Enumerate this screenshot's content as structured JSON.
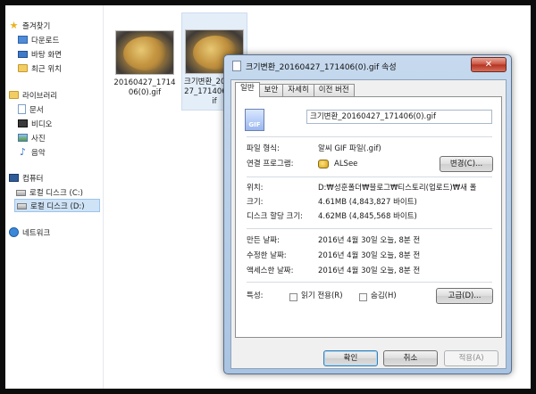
{
  "nav": {
    "items": [
      {
        "label": "즐겨찾기",
        "icon": "star-icon"
      },
      {
        "label": "다운로드",
        "icon": "download-folder-icon"
      },
      {
        "label": "바탕 화면",
        "icon": "desktop-icon"
      },
      {
        "label": "최근 위치",
        "icon": "recent-places-icon"
      },
      {
        "label": "라이브러리",
        "icon": "library-icon"
      },
      {
        "label": "문서",
        "icon": "documents-icon"
      },
      {
        "label": "비디오",
        "icon": "video-icon"
      },
      {
        "label": "사진",
        "icon": "pictures-icon"
      },
      {
        "label": "음악",
        "icon": "music-icon"
      },
      {
        "label": "컴퓨터",
        "icon": "computer-icon"
      },
      {
        "label": "로컬 디스크 (C:)",
        "icon": "drive-c-icon"
      },
      {
        "label": "로컬 디스크 (D:)",
        "icon": "drive-d-icon"
      },
      {
        "label": "네트워크",
        "icon": "network-icon"
      }
    ]
  },
  "files": [
    {
      "name": "20160427_171406(0).gif"
    },
    {
      "name": "크기변환_20160427_171406(0).gif"
    }
  ],
  "dialog": {
    "title": "크기변환_20160427_171406(0).gif 속성",
    "close_label": "✕",
    "tabs": [
      "일반",
      "보안",
      "자세히",
      "이전 버전"
    ],
    "file_name": "크기변환_20160427_171406(0).gif",
    "file_icon_text": "GIF",
    "file_type_label": "파일 형식:",
    "file_type_value": "알씨 GIF 파일(.gif)",
    "opens_with_label": "연결 프로그램:",
    "opens_with_value": "ALSee",
    "change_button": "변경(C)...",
    "location_label": "위치:",
    "location_value": "D:₩성훈폴더₩블로그₩티스토리(업로드)₩새 폴",
    "size_label": "크기:",
    "size_value": "4.61MB (4,843,827 바이트)",
    "size_on_disk_label": "디스크 할당 크기:",
    "size_on_disk_value": "4.62MB (4,845,568 바이트)",
    "created_label": "만든 날짜:",
    "created_value": "2016년 4월 30일 오늘, 8분 전",
    "modified_label": "수정한 날짜:",
    "modified_value": "2016년 4월 30일 오늘, 8분 전",
    "accessed_label": "액세스한 날짜:",
    "accessed_value": "2016년 4월 30일 오늘, 8분 전",
    "attributes_label": "특성:",
    "readonly_label": "읽기 전용(R)",
    "hidden_label": "숨김(H)",
    "advanced_button": "고급(D)...",
    "ok_button": "확인",
    "cancel_button": "취소",
    "apply_button": "적용(A)"
  }
}
